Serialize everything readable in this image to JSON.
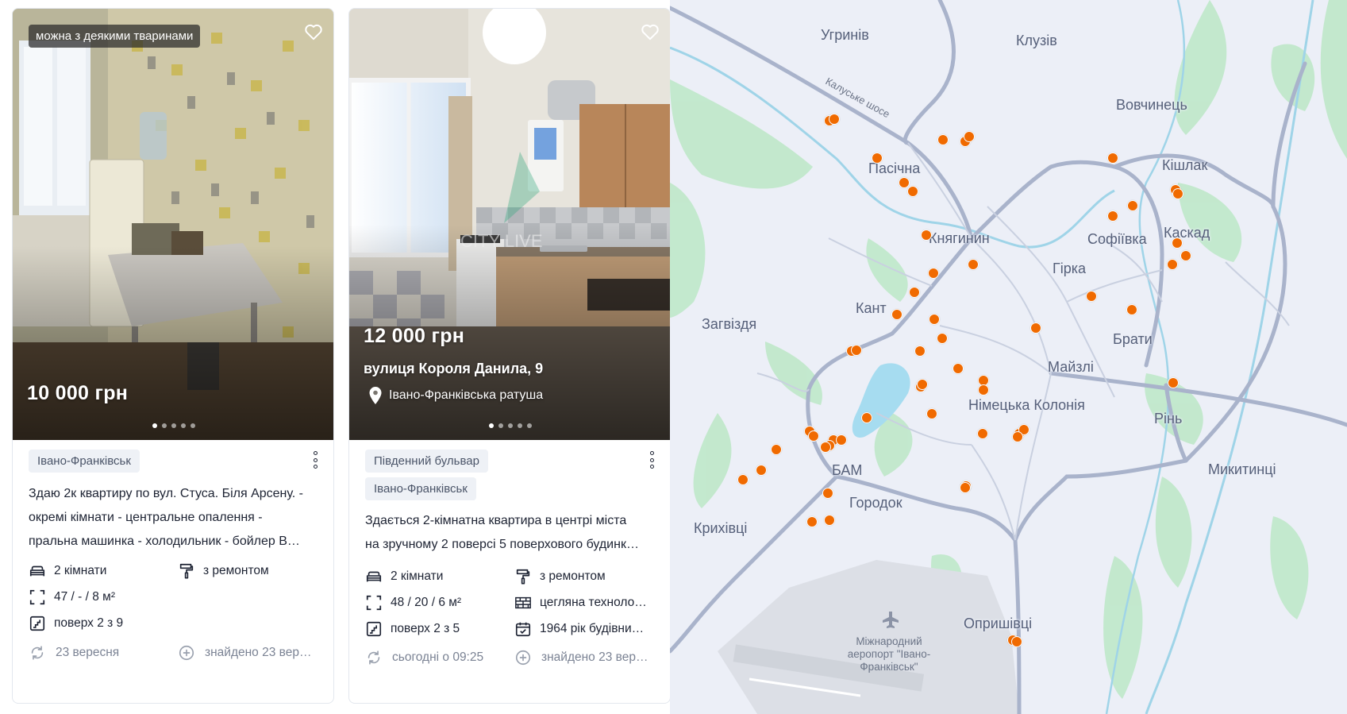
{
  "colors": {
    "accent": "#f06a00",
    "text": "#1d2333",
    "muted": "#7b8394",
    "tag_bg": "#eef1f6",
    "map_bg": "#eceff7"
  },
  "listings": [
    {
      "badge": "можна з деякими тваринами",
      "price": "10 000 грн",
      "tags": [
        "Івано-Франківськ"
      ],
      "description_lines": [
        "Здаю 2к квартиру по вул. Стуса. Біля Арсену. -",
        "окремі кімнати - центральне опалення -",
        "пральна машинка - холодильник - бойлер В…"
      ],
      "features": {
        "rooms": "2 кімнати",
        "condition": "з ремонтом",
        "area": "47 / - / 8 м²",
        "floor": "поверх 2 з 9"
      },
      "updated": "23 вересня",
      "found": "знайдено 23 вер…",
      "photo_count": 5,
      "icons": [
        "heart-icon",
        "sofa-icon",
        "paint-roller-icon",
        "area-icon",
        "stairs-icon",
        "refresh-icon",
        "plus-circle-icon",
        "more-icon"
      ]
    },
    {
      "price": "12 000 грн",
      "address": "вулиця Короля Данила, 9",
      "landmark": "Івано-Франківська ратуша",
      "tags": [
        "Південний бульвар",
        "Івано-Франківськ"
      ],
      "description_lines": [
        "Здається 2-кімнатна квартира в центрі міста",
        "на зручному 2 поверсі 5 поверхового будинк…"
      ],
      "features": {
        "rooms": "2 кімнати",
        "condition": "з ремонтом",
        "area": "48 / 20 / 6 м²",
        "material": "цегляна техноло…",
        "floor": "поверх 2 з 5",
        "year": "1964 рік будівни…"
      },
      "updated": "сьогодні о 09:25",
      "found": "знайдено 23 вер…",
      "photo_count": 5,
      "watermark": "CITY LIVE",
      "icons": [
        "heart-icon",
        "map-pin-icon",
        "sofa-icon",
        "paint-roller-icon",
        "area-icon",
        "brick-icon",
        "stairs-icon",
        "calendar-icon",
        "refresh-icon",
        "plus-circle-icon",
        "more-icon"
      ]
    }
  ],
  "map": {
    "road_label": "Калуське шосе",
    "districts": [
      "Угринів",
      "Клузів",
      "Вовчинець",
      "Пасічна",
      "Кішлак",
      "Софіївка",
      "Каскад",
      "Княгинин",
      "Гірка",
      "Кант",
      "Загвіздя",
      "Брати",
      "Майзлі",
      "Німецька Колонія",
      "Рінь",
      "БАМ",
      "Городок",
      "Микитинці",
      "Крихівці",
      "Опришівці"
    ],
    "airport": "Міжнародний аеропорт \"Івано-Франківськ\"",
    "airport_lines": [
      "Міжнародний",
      "аеропорт \"Івано-",
      "Франківськ\""
    ],
    "listing_pins": 60
  }
}
